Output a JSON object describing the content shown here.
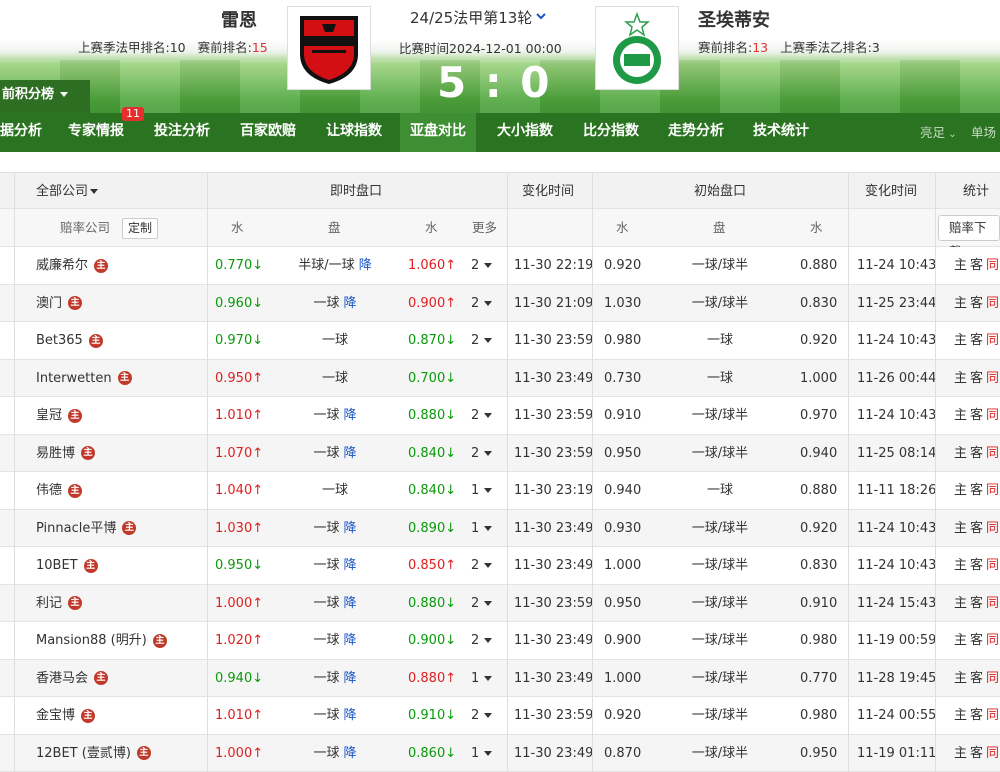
{
  "header": {
    "home_team": "雷恩",
    "home_sub_a": "上赛季法甲排名:10",
    "home_sub_b": "赛前排名:",
    "home_rank": "15",
    "away_team": "圣埃蒂安",
    "away_sub_a": "赛前排名:",
    "away_rank": "13",
    "away_sub_b": "上赛季法乙排名:3",
    "round": "24/25法甲第13轮",
    "match_time": "比赛时间2024-12-01 00:00",
    "score": "5 : 0",
    "points_tab": "前积分榜"
  },
  "nav": {
    "items": [
      "据分析",
      "专家情报",
      "投注分析",
      "百家欧赔",
      "让球指数",
      "亚盘对比",
      "大小指数",
      "比分指数",
      "走势分析",
      "技术统计"
    ],
    "badge": "11",
    "active_index": 5,
    "right_a": "亮足",
    "right_b": "单场"
  },
  "table_head": {
    "all_companies": "全部公司",
    "live_odds": "即时盘口",
    "change_time": "变化时间",
    "initial_odds": "初始盘口",
    "change_time2": "变化时间",
    "stats": "统计",
    "odds_company": "赔率公司",
    "custom": "定制",
    "water1": "水",
    "handicap1": "盘",
    "water2": "水",
    "more": "更多",
    "water3": "水",
    "handicap2": "盘",
    "water4": "水",
    "download": "赔率下载"
  },
  "zhu_label": "主",
  "stats_labels": {
    "home": "主",
    "away": "客",
    "same": "同"
  },
  "rows": [
    {
      "company": "威廉希尔",
      "w1": "0.770",
      "w1d": "down",
      "pan": "半球/一球",
      "jiang": "降",
      "w2": "1.060",
      "w2d": "up",
      "more": "2",
      "t1": "11-30 22:19",
      "iw1": "0.920",
      "ipan": "一球/球半",
      "iw2": "0.880",
      "t2": "11-24 10:43"
    },
    {
      "company": "澳门",
      "w1": "0.960",
      "w1d": "down",
      "pan": "一球",
      "jiang": "降",
      "w2": "0.900",
      "w2d": "up",
      "more": "2",
      "t1": "11-30 21:09",
      "iw1": "1.030",
      "ipan": "一球/球半",
      "iw2": "0.830",
      "t2": "11-25 23:44"
    },
    {
      "company": "Bet365",
      "w1": "0.970",
      "w1d": "down",
      "pan": "一球",
      "jiang": "",
      "w2": "0.870",
      "w2d": "down",
      "more": "2",
      "t1": "11-30 23:59",
      "iw1": "0.980",
      "ipan": "一球",
      "iw2": "0.920",
      "t2": "11-24 10:43"
    },
    {
      "company": "Interwetten",
      "w1": "0.950",
      "w1d": "up",
      "pan": "一球",
      "jiang": "",
      "w2": "0.700",
      "w2d": "down",
      "more": "",
      "t1": "11-30 23:49",
      "iw1": "0.730",
      "ipan": "一球",
      "iw2": "1.000",
      "t2": "11-26 00:44"
    },
    {
      "company": "皇冠",
      "w1": "1.010",
      "w1d": "up",
      "pan": "一球",
      "jiang": "降",
      "w2": "0.880",
      "w2d": "down",
      "more": "2",
      "t1": "11-30 23:59",
      "iw1": "0.910",
      "ipan": "一球/球半",
      "iw2": "0.970",
      "t2": "11-24 10:43"
    },
    {
      "company": "易胜博",
      "w1": "1.070",
      "w1d": "up",
      "pan": "一球",
      "jiang": "降",
      "w2": "0.840",
      "w2d": "down",
      "more": "2",
      "t1": "11-30 23:59",
      "iw1": "0.950",
      "ipan": "一球/球半",
      "iw2": "0.940",
      "t2": "11-25 08:14"
    },
    {
      "company": "伟德",
      "w1": "1.040",
      "w1d": "up",
      "pan": "一球",
      "jiang": "",
      "w2": "0.840",
      "w2d": "down",
      "more": "1",
      "t1": "11-30 23:19",
      "iw1": "0.940",
      "ipan": "一球",
      "iw2": "0.880",
      "t2": "11-11 18:26"
    },
    {
      "company": "Pinnacle平博",
      "w1": "1.030",
      "w1d": "up",
      "pan": "一球",
      "jiang": "降",
      "w2": "0.890",
      "w2d": "down",
      "more": "1",
      "t1": "11-30 23:49",
      "iw1": "0.930",
      "ipan": "一球/球半",
      "iw2": "0.920",
      "t2": "11-24 10:43"
    },
    {
      "company": "10BET",
      "w1": "0.950",
      "w1d": "down",
      "pan": "一球",
      "jiang": "降",
      "w2": "0.850",
      "w2d": "up",
      "more": "2",
      "t1": "11-30 23:49",
      "iw1": "1.000",
      "ipan": "一球/球半",
      "iw2": "0.830",
      "t2": "11-24 10:43"
    },
    {
      "company": "利记",
      "w1": "1.000",
      "w1d": "up",
      "pan": "一球",
      "jiang": "降",
      "w2": "0.880",
      "w2d": "down",
      "more": "2",
      "t1": "11-30 23:59",
      "iw1": "0.950",
      "ipan": "一球/球半",
      "iw2": "0.910",
      "t2": "11-24 15:43"
    },
    {
      "company": "Mansion88 (明升)",
      "w1": "1.020",
      "w1d": "up",
      "pan": "一球",
      "jiang": "降",
      "w2": "0.900",
      "w2d": "down",
      "more": "2",
      "t1": "11-30 23:49",
      "iw1": "0.900",
      "ipan": "一球/球半",
      "iw2": "0.980",
      "t2": "11-19 00:59"
    },
    {
      "company": "香港马会",
      "w1": "0.940",
      "w1d": "down",
      "pan": "一球",
      "jiang": "降",
      "w2": "0.880",
      "w2d": "up",
      "more": "1",
      "t1": "11-30 23:49",
      "iw1": "1.000",
      "ipan": "一球/球半",
      "iw2": "0.770",
      "t2": "11-28 19:45"
    },
    {
      "company": "金宝博",
      "w1": "1.010",
      "w1d": "up",
      "pan": "一球",
      "jiang": "降",
      "w2": "0.910",
      "w2d": "down",
      "more": "2",
      "t1": "11-30 23:59",
      "iw1": "0.920",
      "ipan": "一球/球半",
      "iw2": "0.980",
      "t2": "11-24 00:55"
    },
    {
      "company": "12BET (壹贰博)",
      "w1": "1.000",
      "w1d": "up",
      "pan": "一球",
      "jiang": "降",
      "w2": "0.860",
      "w2d": "down",
      "more": "1",
      "t1": "11-30 23:49",
      "iw1": "0.870",
      "ipan": "一球/球半",
      "iw2": "0.950",
      "t2": "11-19 01:11"
    }
  ]
}
